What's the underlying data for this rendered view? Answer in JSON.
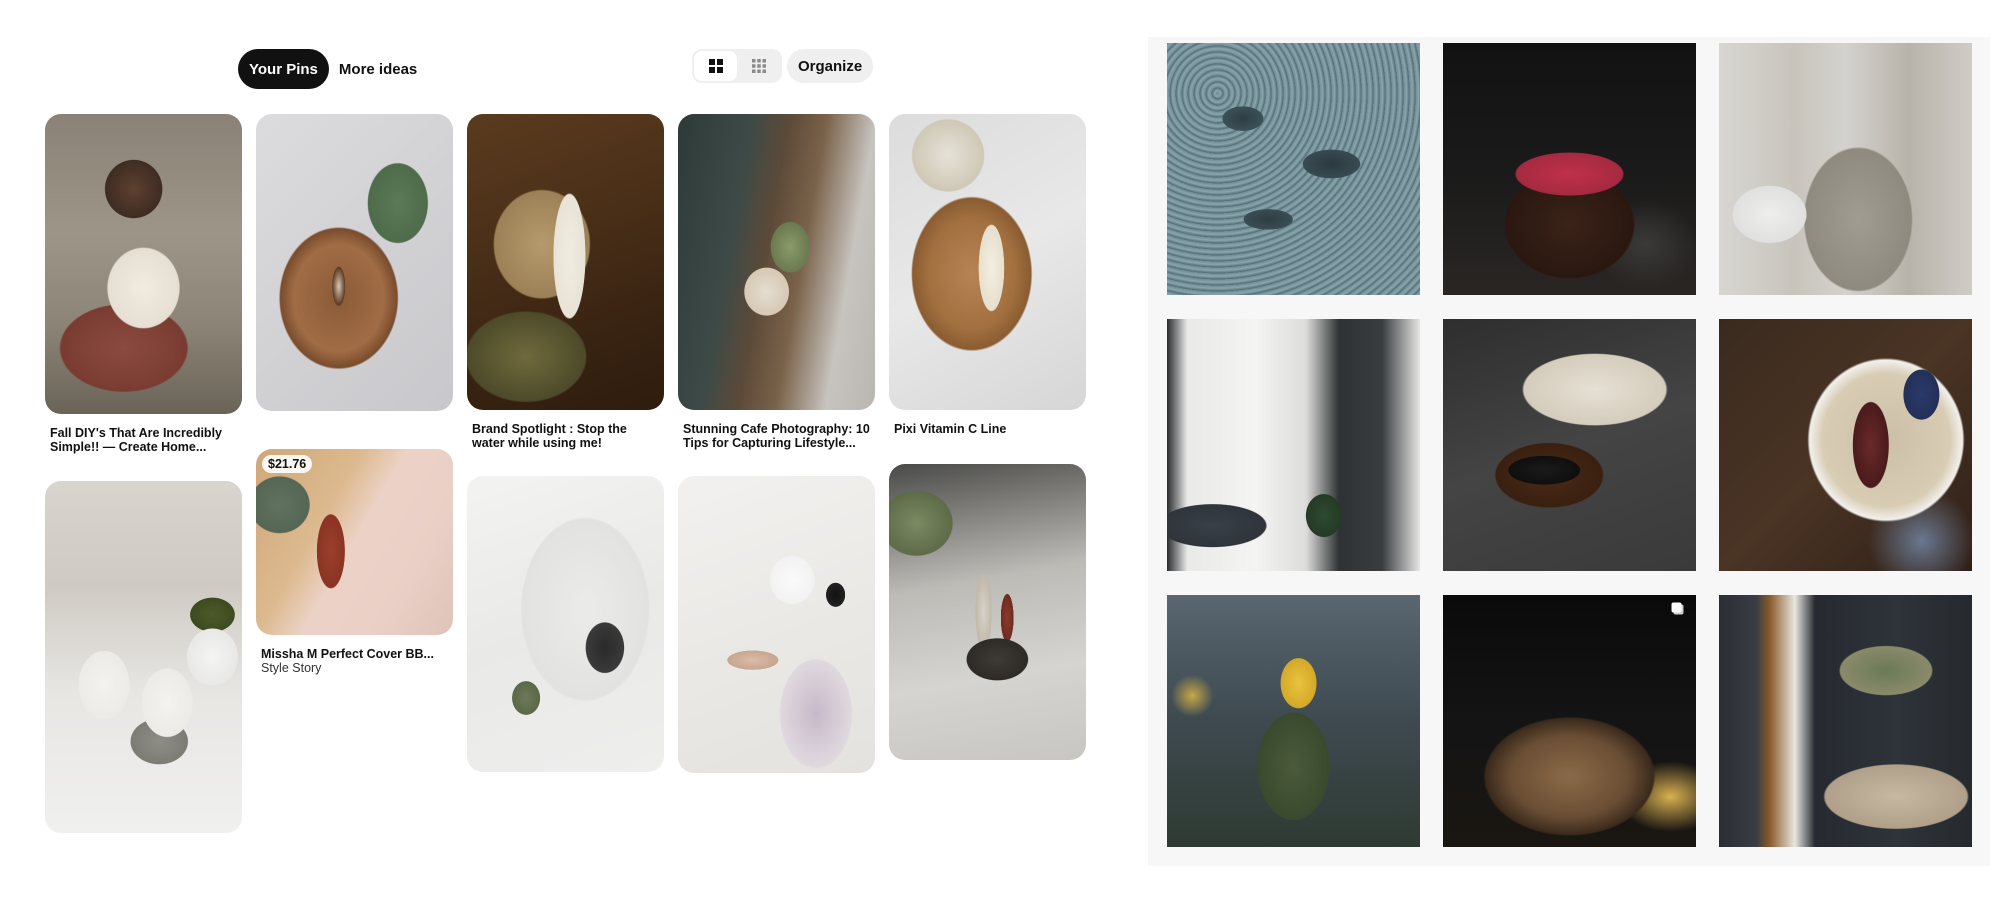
{
  "tabs": {
    "your_pins": "Your Pins",
    "more_ideas": "More ideas"
  },
  "toolbar": {
    "view_default_icon": "grid-2x2-icon",
    "view_compact_icon": "grid-3x3-icon",
    "organize_label": "Organize"
  },
  "pins": [
    {
      "title": "Fall DIY's That Are Incredibly Simple!! — Create Home...",
      "image": "candle-on-books"
    },
    {
      "title": "",
      "image": "serum-on-wood-tray"
    },
    {
      "title": "Brand Spotlight : Stop the water while using me!",
      "image": "tube-on-wicker"
    },
    {
      "title": "Stunning Cafe Photography: 10 Tips for Capturing Lifestyle...",
      "image": "cafe-table"
    },
    {
      "title": "Pixi Vitamin C Line",
      "image": "pixi-on-tray"
    },
    {
      "title": "",
      "image": "egg-candles"
    },
    {
      "title": "Missha M Perfect Cover BB...",
      "subtitle": "Style Story",
      "price": "$21.76",
      "image": "bb-cream-on-fabric"
    },
    {
      "title": "",
      "image": "camera-flatlay"
    },
    {
      "title": "",
      "image": "makeup-flatlay"
    },
    {
      "title": "",
      "image": "bathroom-tray"
    }
  ],
  "grid": [
    {
      "image": "water-droplets"
    },
    {
      "image": "raspberry-cake"
    },
    {
      "image": "kitchen-cabinets"
    },
    {
      "image": "bedroom-window"
    },
    {
      "image": "coffee-and-book"
    },
    {
      "image": "oatmeal-bowl"
    },
    {
      "image": "yellow-flower"
    },
    {
      "image": "bread-loaf",
      "multi_icon": "multiple-images-icon"
    },
    {
      "image": "dark-bedroom"
    }
  ]
}
